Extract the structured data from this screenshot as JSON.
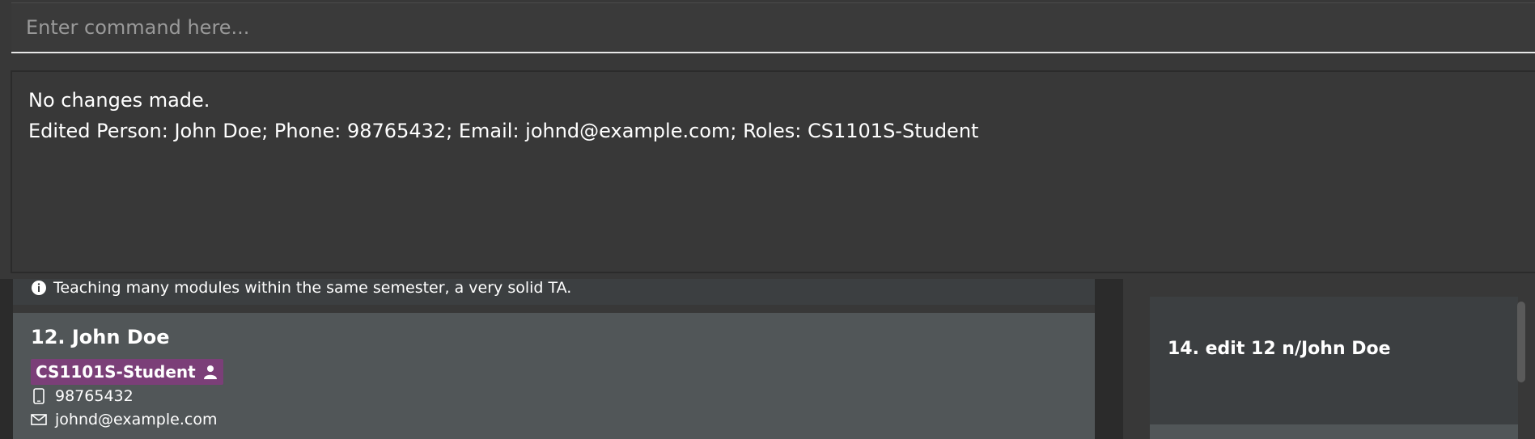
{
  "command_box": {
    "placeholder": "Enter command here..."
  },
  "result_display": {
    "lines": [
      "No changes made.",
      "Edited Person: John Doe; Phone: 98765432; Email: johnd@example.com; Roles: CS1101S-Student"
    ]
  },
  "person_list": {
    "previous_item_text": "Teaching many modules within the same semester, a very solid TA.",
    "selected_person": {
      "name": "12. John Doe",
      "role": "CS1101S-Student",
      "phone": "98765432",
      "email": "johnd@example.com"
    }
  },
  "history_panel": {
    "item_label": "14. edit 12 n/John Doe"
  },
  "icons": {
    "previous_item_icon": "info-icon",
    "role_icon": "person-icon",
    "phone_icon": "phone-icon",
    "email_icon": "email-icon"
  },
  "colors": {
    "background": "#383838",
    "panel_dark": "#2b2b2b",
    "card_selected": "#515658",
    "card_default": "#3c3f41",
    "role_badge": "#7b3f78",
    "text": "#ffffff"
  }
}
